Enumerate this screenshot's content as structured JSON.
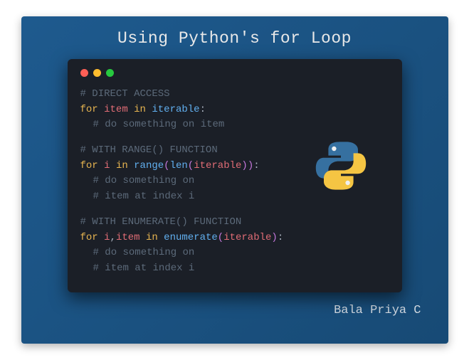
{
  "title": "Using Python's for Loop",
  "author": "Bala Priya C",
  "code": {
    "block1": {
      "header": "# DIRECT ACCESS",
      "kw_for": "for",
      "var1": "item",
      "kw_in": "in",
      "var2": "iterable",
      "colon": ":",
      "body1": "# do something on item"
    },
    "block2": {
      "header": "# WITH RANGE() FUNCTION",
      "kw_for": "for",
      "var1": "i",
      "kw_in": "in",
      "func1": "range",
      "paren_l1": "(",
      "func2": "len",
      "paren_l2": "(",
      "var2": "iterable",
      "paren_r2": ")",
      "paren_r1": ")",
      "colon": ":",
      "body1": "# do something on",
      "body2": "# item at index i"
    },
    "block3": {
      "header": "# WITH ENUMERATE() FUNCTION",
      "kw_for": "for",
      "var1": "i",
      "comma": ",",
      "var1b": "item",
      "kw_in": "in",
      "func1": "enumerate",
      "paren_l": "(",
      "var2": "iterable",
      "paren_r": ")",
      "colon": ":",
      "body1": "# do something on",
      "body2": "# item at index i"
    }
  }
}
